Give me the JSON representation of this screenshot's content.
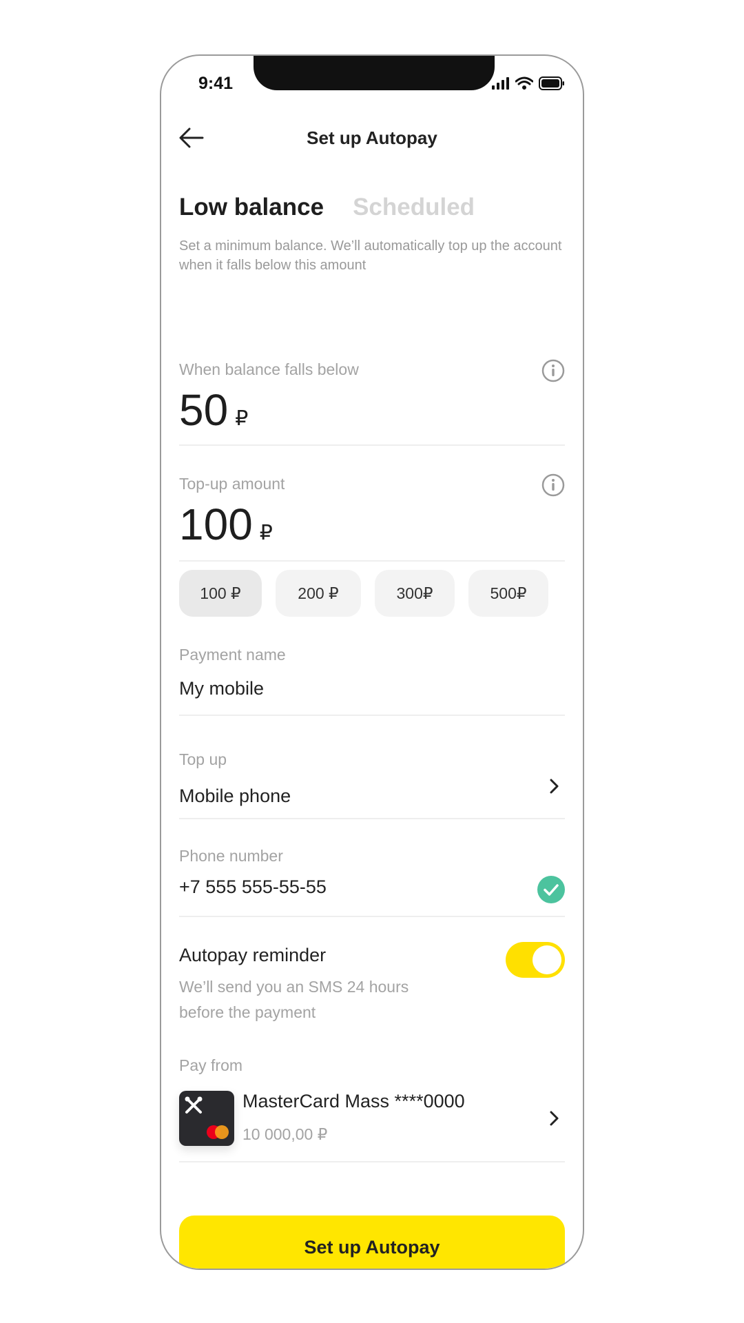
{
  "status_bar": {
    "time": "9:41",
    "icons": [
      "signal-icon",
      "wifi-icon",
      "battery-icon"
    ]
  },
  "header": {
    "title": "Set up Autopay",
    "back_icon": "back-arrow-icon"
  },
  "tabs": [
    {
      "label": "Low balance",
      "active": true
    },
    {
      "label": "Scheduled",
      "active": false
    }
  ],
  "description": "Set a minimum balance. We’ll automatically top up the account when it falls below this amount",
  "threshold": {
    "label": "When balance falls below",
    "value": "50",
    "currency": "₽",
    "icon": "info-icon"
  },
  "topup_amount": {
    "label": "Top-up amount",
    "value": "100",
    "currency": "₽",
    "icon": "info-icon"
  },
  "amount_chips": [
    {
      "label": "100 ₽",
      "selected": true
    },
    {
      "label": "200 ₽",
      "selected": false
    },
    {
      "label": "300₽",
      "selected": false
    },
    {
      "label": "500₽",
      "selected": false
    }
  ],
  "payment_name": {
    "label": "Payment name",
    "value": "My mobile"
  },
  "top_up": {
    "label": "Top up",
    "value": "Mobile phone"
  },
  "phone": {
    "label": "Phone number",
    "value": "+7 555 555-55-55",
    "verified": true
  },
  "reminder": {
    "title": "Autopay reminder",
    "subtitle": "We’ll send you an SMS 24 hours before the payment",
    "enabled": true
  },
  "pay_from": {
    "label": "Pay from",
    "card_name": "MasterCard Mass ****0000",
    "balance": "10 000,00 ₽"
  },
  "primary_button": {
    "label": "Set up Autopay"
  },
  "colors": {
    "accent": "#ffe600",
    "toggle": "#ffe000",
    "success": "#4cc39e",
    "text": "#1e1e1e",
    "muted": "#a3a3a3",
    "chip": "#f3f3f3",
    "card": "#2a2a2e"
  }
}
